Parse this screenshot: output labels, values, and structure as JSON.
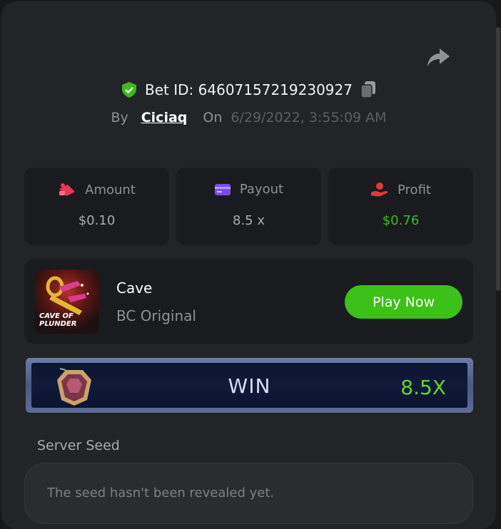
{
  "bet": {
    "id_label": "Bet ID: 64607157219230927",
    "by_label": "By",
    "user": "Ciciaq",
    "on_label": "On",
    "date": "6/29/2022, 3:55:09 AM"
  },
  "stats": [
    {
      "label": "Amount",
      "value": "$0.10"
    },
    {
      "label": "Payout",
      "value": "8.5 x"
    },
    {
      "label": "Profit",
      "value": "$0.76"
    }
  ],
  "game": {
    "title": "Cave",
    "subtitle": "BC Original",
    "thumb_text_1": "CAVE OF",
    "thumb_text_2": "PLUNDER",
    "play_label": "Play Now"
  },
  "result": {
    "label": "WIN",
    "multiplier": "8.5X"
  },
  "seed": {
    "label": "Server Seed",
    "value": "The seed hasn't been revealed yet."
  },
  "colors": {
    "accent_green": "#3bc117",
    "profit_green": "#3dbb1b",
    "amount_icon": "#e8365a",
    "payout_icon": "#7a4bf0",
    "profit_icon": "#e8363e"
  },
  "icons": [
    "share-icon",
    "shield-check-icon",
    "copy-icon",
    "amount-icon",
    "payout-card-icon",
    "profit-hand-icon",
    "gem-icon"
  ]
}
